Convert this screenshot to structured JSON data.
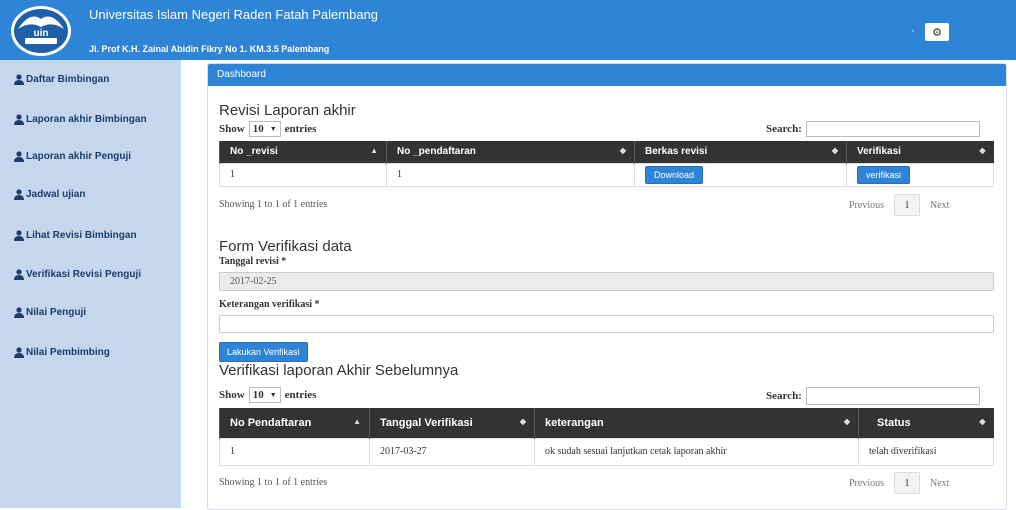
{
  "header": {
    "university_name": "Universitas Islam Negeri Raden Fatah Palembang",
    "address": "Jl. Prof K.H. Zainal Abidin Fikry No 1. KM.3.5 Palembang",
    "logo_text": "uin",
    "dot": "·",
    "settings_icon": "gear-icon",
    "colors": {
      "topbar": "#2e84d7",
      "sidebar": "#c5d7ec",
      "table_header": "#333333"
    }
  },
  "sidebar": {
    "items": [
      {
        "label": "Daftar Bimbingan"
      },
      {
        "label": "Laporan akhir Bimbingan"
      },
      {
        "label": "Laporan akhir Penguji"
      },
      {
        "label": "Jadwal ujian"
      },
      {
        "label": "Lihat Revisi Bimbingan"
      },
      {
        "label": "Verifikasi Revisi Penguji"
      },
      {
        "label": "Nilai Penguji"
      },
      {
        "label": "Nilai Pembimbing"
      }
    ]
  },
  "panel": {
    "heading": "Dashboard"
  },
  "revisi": {
    "title": "Revisi Laporan akhir",
    "show": "Show",
    "length": "10",
    "entries": "entries",
    "search_label": "Search:",
    "columns": [
      "No _revisi",
      "No _pendaftaran",
      "Berkas revisi",
      "Verifikasi"
    ],
    "row": {
      "no_revisi": "1",
      "no_pendaftaran": "1",
      "download_label": "Download",
      "verifikasi_label": "verifikasi"
    },
    "info": "Showing 1 to 1 of 1 entries",
    "previous": "Previous",
    "page": "1",
    "next": "Next"
  },
  "form": {
    "title": "Form Verifikasi data",
    "tanggal_label": "Tanggal revisi *",
    "tanggal_value": "2017-02-25",
    "keterangan_label": "Keterangan verifikasi *",
    "keterangan_value": "",
    "submit_label": "Lakukan Verifikasi"
  },
  "history": {
    "title": "Verifikasi laporan Akhir Sebelumnya",
    "show": "Show",
    "length": "10",
    "entries": "entries",
    "search_label": "Search:",
    "columns": [
      "No Pendaftaran",
      "Tanggal Verifikasi",
      "keterangan",
      "Status"
    ],
    "row": {
      "no_pendaftaran": "1",
      "tanggal": "2017-03-27",
      "keterangan": "ok sudah sesuai lanjutkan cetak laporan akhir",
      "status": "telah diverifikasi"
    },
    "info": "Showing 1 to 1 of 1 entries",
    "previous": "Previous",
    "page": "1",
    "next": "Next"
  }
}
